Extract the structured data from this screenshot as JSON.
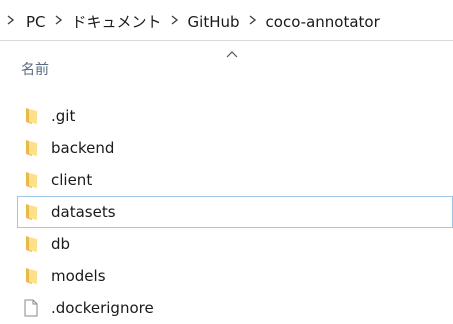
{
  "breadcrumb": {
    "items": [
      "PC",
      "ドキュメント",
      "GitHub",
      "coco-annotator"
    ]
  },
  "header": {
    "name_column": "名前"
  },
  "files": [
    {
      "name": ".git",
      "type": "folder"
    },
    {
      "name": "backend",
      "type": "folder"
    },
    {
      "name": "client",
      "type": "folder"
    },
    {
      "name": "datasets",
      "type": "folder",
      "hovered": true
    },
    {
      "name": "db",
      "type": "folder"
    },
    {
      "name": "models",
      "type": "folder"
    },
    {
      "name": ".dockerignore",
      "type": "file"
    }
  ],
  "colors": {
    "folder_front": "#ffe08a",
    "folder_back": "#e8b84a",
    "hover_border": "#9fc6e7"
  }
}
